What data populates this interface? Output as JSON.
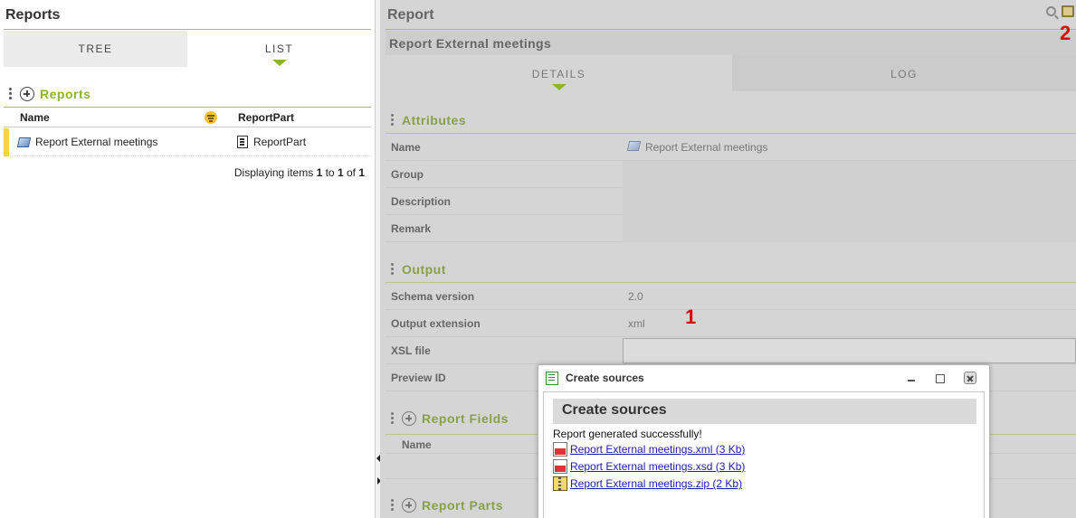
{
  "left_panel": {
    "title": "Reports",
    "tabs": {
      "tree": "TREE",
      "list": "LIST"
    },
    "section_title": "Reports",
    "columns": {
      "name": "Name",
      "report_part": "ReportPart"
    },
    "rows": [
      {
        "name": "Report External meetings",
        "report_part": "ReportPart"
      }
    ],
    "paging": {
      "prefix": "Displaying items ",
      "from": "1",
      "to_word": " to ",
      "to": "1",
      "of_word": " of ",
      "total": "1"
    }
  },
  "right_panel": {
    "title": "Report",
    "subtitle": "Report External meetings",
    "tabs": {
      "details": "DETAILS",
      "log": "LOG"
    },
    "attributes": {
      "title": "Attributes",
      "fields": [
        {
          "label": "Name",
          "value": "Report External meetings"
        },
        {
          "label": "Group",
          "value": ""
        },
        {
          "label": "Description",
          "value": ""
        },
        {
          "label": "Remark",
          "value": ""
        }
      ]
    },
    "output": {
      "title": "Output",
      "fields": [
        {
          "label": "Schema version",
          "value": "2.0"
        },
        {
          "label": "Output extension",
          "value": "xml"
        },
        {
          "label": "XSL file",
          "value": ""
        },
        {
          "label": "Preview ID",
          "value": ""
        }
      ]
    },
    "report_fields": {
      "title": "Report Fields",
      "column": "Name"
    },
    "report_parts": {
      "title": "Report Parts"
    }
  },
  "annotations": {
    "one": "1",
    "two": "2"
  },
  "modal": {
    "window_title": "Create sources",
    "heading": "Create sources",
    "message": "Report generated successfully!",
    "files": [
      {
        "label": " Report External meetings.xml (3 Kb)",
        "icon": "xml-file-icon"
      },
      {
        "label": " Report External meetings.xsd (3 Kb)",
        "icon": "xsd-file-icon"
      },
      {
        "label": " Report External meetings.zip (2 Kb)",
        "icon": "zip-file-icon"
      }
    ]
  },
  "colors": {
    "accent": "#8cb52b",
    "annotation_red": "#e00000",
    "link": "#1a1ab5"
  }
}
